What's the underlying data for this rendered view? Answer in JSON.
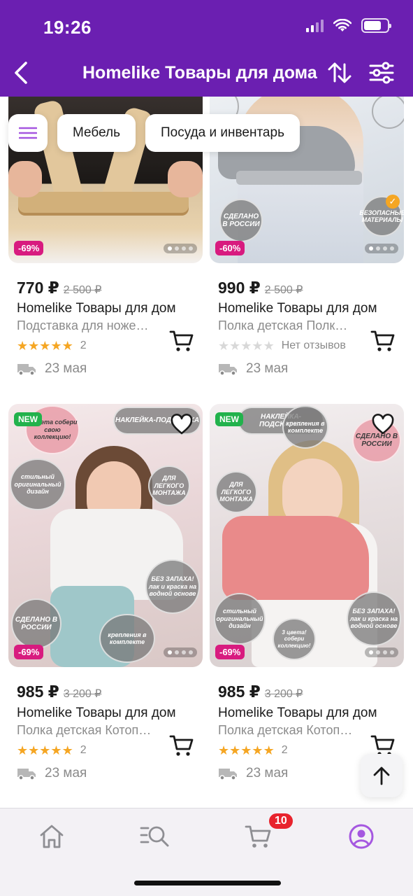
{
  "status_bar": {
    "time": "19:26"
  },
  "header": {
    "title": "Homelike Товары для дома",
    "back_icon": "chevron-left-icon",
    "sort_icon": "sort-arrows-icon",
    "filter_icon": "filter-sliders-icon",
    "bg_color": "#6b1fb1"
  },
  "chips": [
    {
      "label": "Мебель"
    },
    {
      "label": "Посуда и инвентарь"
    }
  ],
  "products": [
    {
      "discount": "-69%",
      "price": "770 ₽",
      "old_price": "2 500 ₽",
      "seller": "Homelike Товары для дом",
      "name": "Подставка для ноже…",
      "rating_value": 5,
      "rating_count": "2",
      "delivery": "23 мая",
      "image_texts": []
    },
    {
      "discount": "-60%",
      "price": "990 ₽",
      "old_price": "2 500 ₽",
      "seller": "Homelike Товары для дом",
      "name": "Полка детская Полк…",
      "rating_value": 0,
      "rating_count": "Нет отзывов",
      "delivery": "23 мая",
      "image_texts": [
        "СДЕЛАНО В РОССИИ",
        "БЕЗОПАСНЫЕ МАТЕРИАЛЫ"
      ]
    },
    {
      "discount": "-69%",
      "badge": "NEW",
      "price": "985 ₽",
      "old_price": "3 200 ₽",
      "seller": "Homelike Товары для дом",
      "name": "Полка детская Котоп…",
      "rating_value": 5,
      "rating_count": "2",
      "delivery": "23 мая",
      "image_texts": [
        "3 цвета собери свою коллекцию!",
        "НАКЛЕЙКА-ПОДСКАЗКА",
        "стильный оригинальный дизайн",
        "ДЛЯ ЛЕГКОГО МОНТАЖА",
        "БЕЗ ЗАПАХА! лак и краска на водной основе",
        "СДЕЛАНО В РОССИИ",
        "крепления в комплекте"
      ]
    },
    {
      "discount": "-69%",
      "badge": "NEW",
      "price": "985 ₽",
      "old_price": "3 200 ₽",
      "seller": "Homelike Товары для дом",
      "name": "Полка детская Котоп…",
      "rating_value": 5,
      "rating_count": "2",
      "delivery": "23 мая",
      "image_texts": [
        "НАКЛЕЙКА-ПОДСКАЗКА",
        "крепления в комплекте",
        "СДЕЛАНО В РОССИИ",
        "ДЛЯ ЛЕГКОГО МОНТАЖА",
        "стильный оригинальный дизайн",
        "БЕЗ ЗАПАХА! лак и краска на водной основе",
        "3 цвета! собери коллекцию!"
      ]
    }
  ],
  "bottom_nav": {
    "tabs": [
      {
        "icon": "home-icon"
      },
      {
        "icon": "catalog-search-icon"
      },
      {
        "icon": "cart-icon"
      },
      {
        "icon": "profile-icon",
        "active": true
      }
    ],
    "cart_count": "10",
    "accent_color": "#a557e0"
  },
  "colors": {
    "discount": "#d81b7f",
    "new_badge": "#22b24c",
    "star": "#f5a623",
    "star_empty": "#d8d8d8"
  }
}
